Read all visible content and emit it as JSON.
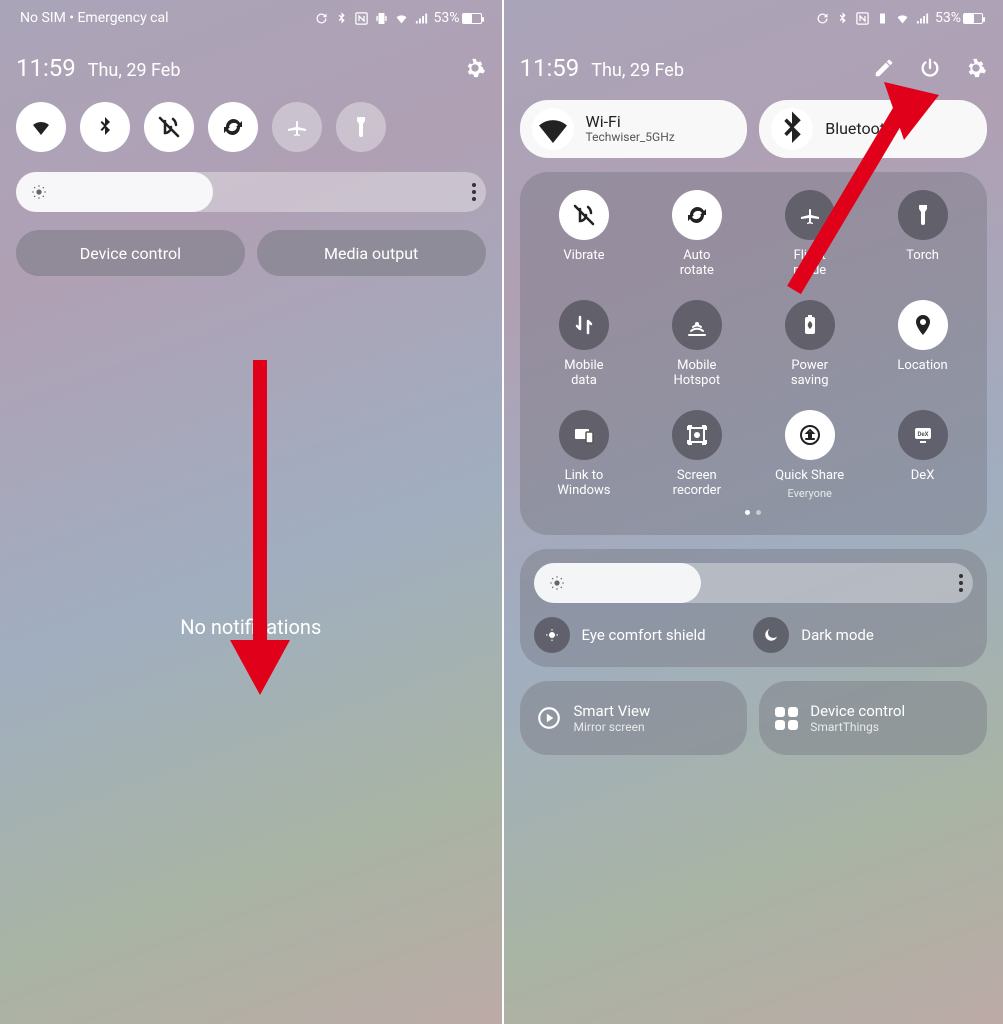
{
  "status": {
    "no_sim": "No SIM • Emergency cal",
    "battery_pct": "53%",
    "battery_fill": 53
  },
  "clock": {
    "time": "11:59",
    "date": "Thu, 29 Feb"
  },
  "left": {
    "device_control": "Device control",
    "media_output": "Media output",
    "no_notifications": "No notifications",
    "brightness_pct": 42
  },
  "right": {
    "wifi": {
      "title": "Wi-Fi",
      "subtitle": "Techwiser_5GHz"
    },
    "bt": {
      "title": "Bluetooth"
    },
    "tiles": {
      "vibrate": "Vibrate",
      "auto_rotate_1": "Auto",
      "auto_rotate_2": "rotate",
      "flight_1": "Flight",
      "flight_2": "mode",
      "torch": "Torch",
      "mobile_data_1": "Mobile",
      "mobile_data_2": "data",
      "hotspot_1": "Mobile",
      "hotspot_2": "Hotspot",
      "power_1": "Power",
      "power_2": "saving",
      "location": "Location",
      "link_1": "Link to",
      "link_2": "Windows",
      "screenrec_1": "Screen",
      "screenrec_2": "recorder",
      "quickshare": "Quick Share",
      "quickshare_sub": "Everyone",
      "dex": "DeX"
    },
    "brightness_pct": 38,
    "eye_comfort": "Eye comfort shield",
    "dark_mode": "Dark mode",
    "smart_view": {
      "title": "Smart View",
      "subtitle": "Mirror screen"
    },
    "device_control": {
      "title": "Device control",
      "subtitle": "SmartThings"
    }
  }
}
